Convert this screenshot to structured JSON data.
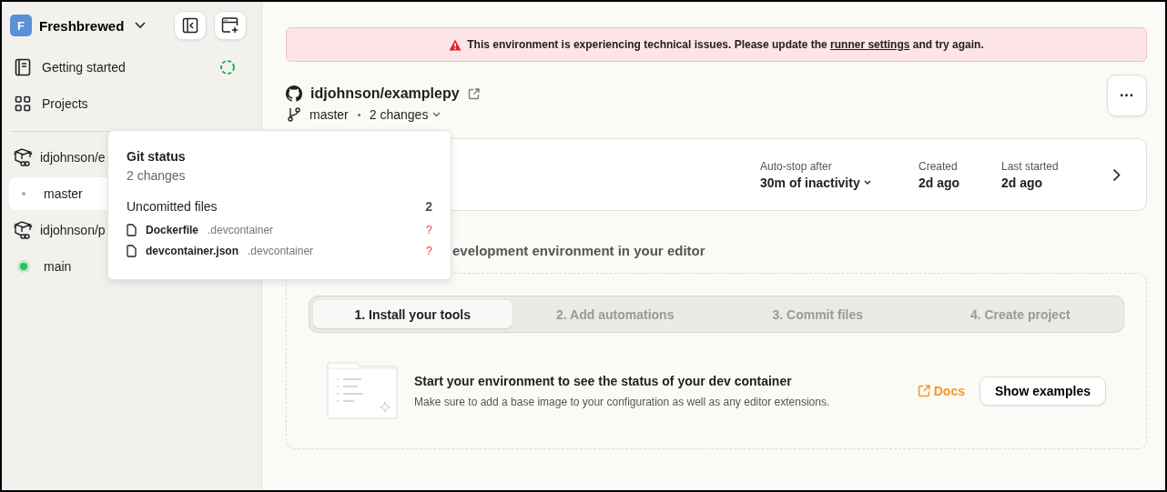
{
  "workspace": {
    "initial": "F",
    "name": "Freshbrewed"
  },
  "nav": [
    {
      "label": "Getting started",
      "kind": "guide",
      "loading": true
    },
    {
      "label": "Projects",
      "kind": "grid",
      "loading": false
    }
  ],
  "environments": [
    {
      "repo": "idjohnson/e",
      "branches": [
        {
          "name": "master",
          "selected": true,
          "running": false
        }
      ]
    },
    {
      "repo": "idjohnson/p",
      "branches": [
        {
          "name": "main",
          "selected": false,
          "running": true
        }
      ]
    }
  ],
  "alert": {
    "before": "This environment is experiencing technical issues. Please update the",
    "link": "runner settings",
    "after": "and try again."
  },
  "repo": {
    "name": "idjohnson/examplepy",
    "branch": "master",
    "changes": "2 changes",
    "menu": "···"
  },
  "environment_card": {
    "fields": [
      {
        "label": "Auto-stop after",
        "value": "30m of inactivity",
        "kind": "dropdown"
      },
      {
        "label": "Created",
        "value": "2d ago",
        "kind": "text"
      },
      {
        "label": "Last started",
        "value": "2d ago",
        "kind": "text"
      }
    ]
  },
  "heading": "evelopment environment in your editor",
  "steps": [
    {
      "label": "1. Install your tools",
      "selected": true
    },
    {
      "label": "2. Add automations",
      "selected": false
    },
    {
      "label": "3. Commit files",
      "selected": false
    },
    {
      "label": "4. Create project",
      "selected": false
    }
  ],
  "instructions": {
    "title": "Start your environment to see the status of your dev container",
    "description": "Make sure to add a base image to your configuration as well as any editor extensions.",
    "docs": "Docs",
    "button": "Show examples"
  },
  "git_status": {
    "title": "Git status",
    "summary": "2 changes",
    "section": "Uncomitted files",
    "count": "2",
    "files": [
      {
        "name": "Dockerfile",
        "dir": ".devcontainer",
        "status": "?"
      },
      {
        "name": "devcontainer.json",
        "dir": ".devcontainer",
        "status": "?"
      }
    ]
  }
}
